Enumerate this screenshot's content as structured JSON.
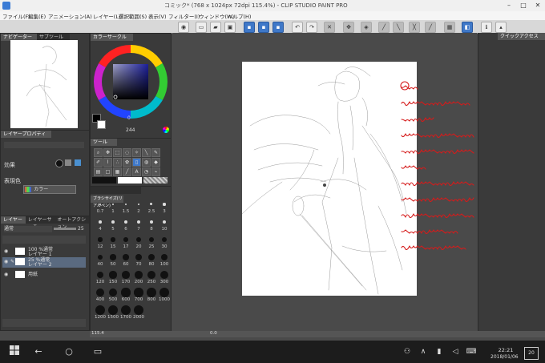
{
  "window": {
    "title": "コミック* (768 x 1024px 72dpi 115.4%) - CLIP STUDIO PAINT PRO",
    "controls": [
      "–",
      "□",
      "✕"
    ]
  },
  "menu": [
    "ファイル(F)",
    "編集(E)",
    "アニメーション(A)",
    "レイヤー(L)",
    "選択範囲(S)",
    "表示(V)",
    "フィルター(I)",
    "ウィンドウ(W)",
    "ヘルプ(H)"
  ],
  "panels": {
    "navigator_tab": "ナビゲーター",
    "navigator_tab2": "サブツール",
    "colorwheel_tab": "カラーサークル",
    "color_values": {
      "left": "244",
      "right": "0"
    },
    "nav_zoom": "115.4",
    "tool_property_tab": "レイヤープロパティ",
    "tool_property": {
      "effect_label": "効果",
      "expr_label": "表現色",
      "expr_value": "カラー"
    },
    "layers_tabs": [
      "レイヤー",
      "レイヤーサーチ",
      "オートアクション"
    ],
    "layers": {
      "blend_mode": "通常",
      "opacity": "25",
      "rows": [
        {
          "name": "100 %通常",
          "sub": "レイヤー 1"
        },
        {
          "name": "25 %通常",
          "sub": "レイヤー 2"
        },
        {
          "name": "用紙",
          "sub": ""
        }
      ]
    },
    "tool_tab": "ツール",
    "brush_size_tab": "ブラシサイズ(リアルペン)",
    "right_panel_tab": "クイックアクセス",
    "brush_sizes": [
      [
        "0.7",
        "1",
        "1.5",
        "2",
        "2.5",
        "3"
      ],
      [
        "4",
        "5",
        "6",
        "7",
        "8",
        "10"
      ],
      [
        "12",
        "15",
        "17",
        "20",
        "25",
        "30"
      ],
      [
        "40",
        "50",
        "60",
        "70",
        "80",
        "100"
      ],
      [
        "120",
        "150",
        "170",
        "200",
        "250",
        "300"
      ],
      [
        "400",
        "500",
        "600",
        "700",
        "800",
        "1000"
      ],
      [
        "1200",
        "1500",
        "1700",
        "2000",
        "",
        ""
      ]
    ]
  },
  "status": {
    "zoom": "115.4",
    "left": "0.0"
  },
  "annotation_lines": [
    "①ラフ",
    "雰囲気が掴めればごちゃくても",
    "問題はないです",
    "らくがきとか思いつきで描く",
    "もの時描のないことの方が",
    "多いです",
    "なんかごちゃごちゃしてきて",
    "わけわからなくなったので今回は",
    "線画の途中に補助線的な",
    "感じで描きました",
    "お手軽楽しいです"
  ],
  "taskbar": {
    "time": "22:21",
    "date": "2018/01/06",
    "notification_count": "20"
  },
  "colors": {
    "annotation": "#d51b1b",
    "accent": "#3f78c8",
    "panel": "#3a3a3a",
    "canvas_bg": "#4a4a4a"
  },
  "icons": [
    "app-icon",
    "back-arrow-icon",
    "home-circle-icon",
    "task-view-icon",
    "people-icon",
    "network-icon",
    "volume-icon",
    "keyboard-icon",
    "notification-icon"
  ]
}
